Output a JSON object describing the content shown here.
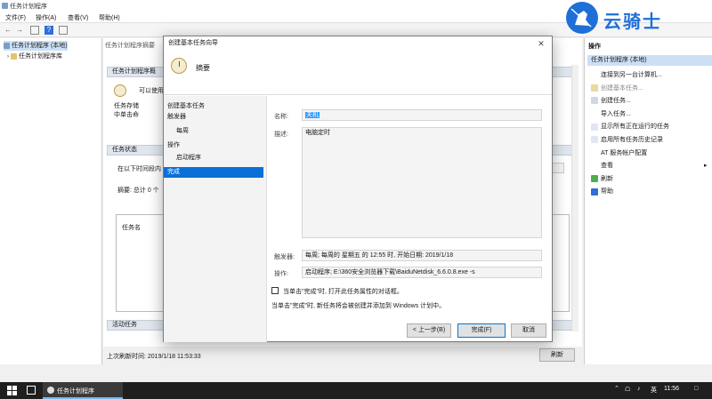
{
  "window": {
    "title": "任务计划程序"
  },
  "menu": [
    "文件(F)",
    "操作(A)",
    "查看(V)",
    "帮助(H)"
  ],
  "tree": {
    "root": "任务计划程序 (本地)",
    "child": "任务计划程序库"
  },
  "middle": {
    "breadcrumb": "任务计划程序摘要",
    "section1": "任务计划程序概",
    "intro_line1": "可以使用",
    "intro_line2": "任务存储",
    "intro_line3": "中单击命",
    "status_header": "任务状态",
    "status_line": "在以下时间段内",
    "summary": "摘要: 总计 0 个",
    "task_col": "任务名",
    "active_header": "活动任务",
    "last_refresh": "上次刷新时间: 2019/1/18 11:53:33",
    "refresh_button": "刷新"
  },
  "actions": {
    "header": "操作",
    "sub_header": "任务计划程序 (本地)",
    "items": [
      {
        "label": "连接到另一台计算机...",
        "icon": "computer-icon",
        "color": "#ffffff"
      },
      {
        "label": "创建基本任务...",
        "icon": "wizard-icon",
        "color": "#e8d9a0",
        "dim": true
      },
      {
        "label": "创建任务...",
        "icon": "task-icon",
        "color": "#d0d8e6"
      },
      {
        "label": "导入任务...",
        "icon": "import-icon",
        "color": "#ffffff"
      },
      {
        "label": "显示所有正在运行的任务",
        "icon": "running-icon",
        "color": "#dfe7f2"
      },
      {
        "label": "启用所有任务历史记录",
        "icon": "history-icon",
        "color": "#dfe7f2"
      },
      {
        "label": "AT 服务帐户配置",
        "icon": "at-icon",
        "color": "#ffffff"
      },
      {
        "label": "查看",
        "icon": "view-icon",
        "color": "#ffffff"
      },
      {
        "label": "刷新",
        "icon": "refresh-icon",
        "color": "#4caf50"
      },
      {
        "label": "帮助",
        "icon": "help-icon",
        "color": "#2f6fd6"
      }
    ]
  },
  "dialog": {
    "title": "创建基本任务向导",
    "heading": "摘要",
    "steps": [
      "创建基本任务",
      "触发器",
      "每周",
      "操作",
      "启动程序",
      "完成"
    ],
    "name_label": "名称:",
    "name_value": "关机",
    "desc_label": "描述:",
    "desc_value": "电脑定时",
    "trigger_label": "触发器:",
    "trigger_value": "每周; 每周的 星期五 的 12:55 时, 开始日期: 2019/1/18",
    "action_label": "操作:",
    "action_value": "启动程序; E:\\360安全浏览器下载\\BaiduNetdisk_6.6.0.8.exe -s",
    "checkbox_label": "当单击\"完成\"时, 打开此任务属性的对话框。",
    "finish_note": "当单击\"完成\"时, 新任务将会被创建并添加到 Windows 计划中。",
    "back_button": "< 上一步(B)",
    "finish_button": "完成(F)",
    "cancel_button": "取消"
  },
  "watermark": {
    "text": "云骑士"
  },
  "taskbar": {
    "app_label": "任务计划程序",
    "ime": "英",
    "clock": "11:56"
  }
}
